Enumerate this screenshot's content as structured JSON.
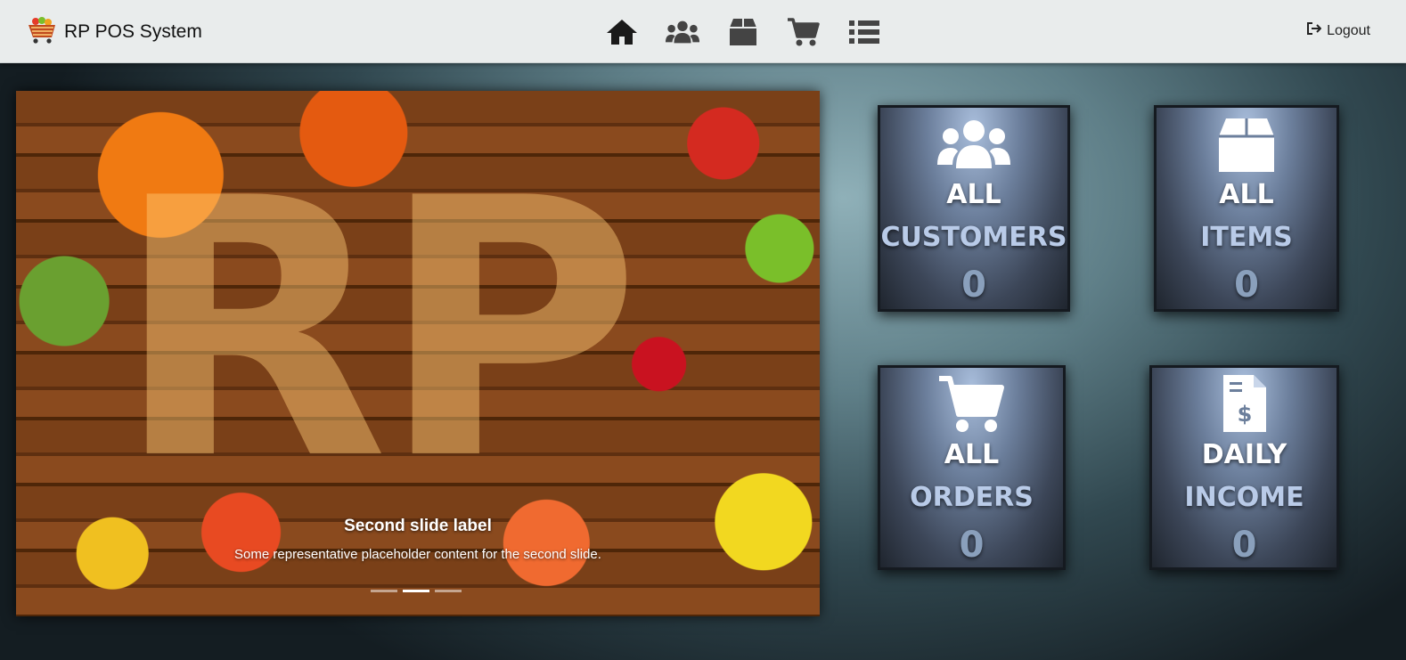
{
  "app": {
    "title": "RP POS System"
  },
  "nav": {
    "icons": [
      "home-icon",
      "customers-icon",
      "items-icon",
      "cart-icon",
      "list-icon"
    ]
  },
  "logout": {
    "label": "Logout"
  },
  "carousel": {
    "logo_text": "RP",
    "caption_title": "Second slide label",
    "caption_text": "Some representative placeholder content for the second slide.",
    "active_slide": 2,
    "slide_count": 3
  },
  "cards": [
    {
      "icon": "users-icon",
      "line1": "ALL",
      "line2": "CUSTOMERS",
      "count": "0"
    },
    {
      "icon": "box-icon",
      "line1": "ALL",
      "line2": "ITEMS",
      "count": "0"
    },
    {
      "icon": "cart-icon",
      "line1": "ALL",
      "line2": "ORDERS",
      "count": "0"
    },
    {
      "icon": "invoice-icon",
      "line1": "DAILY",
      "line2": "INCOME",
      "count": "0"
    }
  ]
}
